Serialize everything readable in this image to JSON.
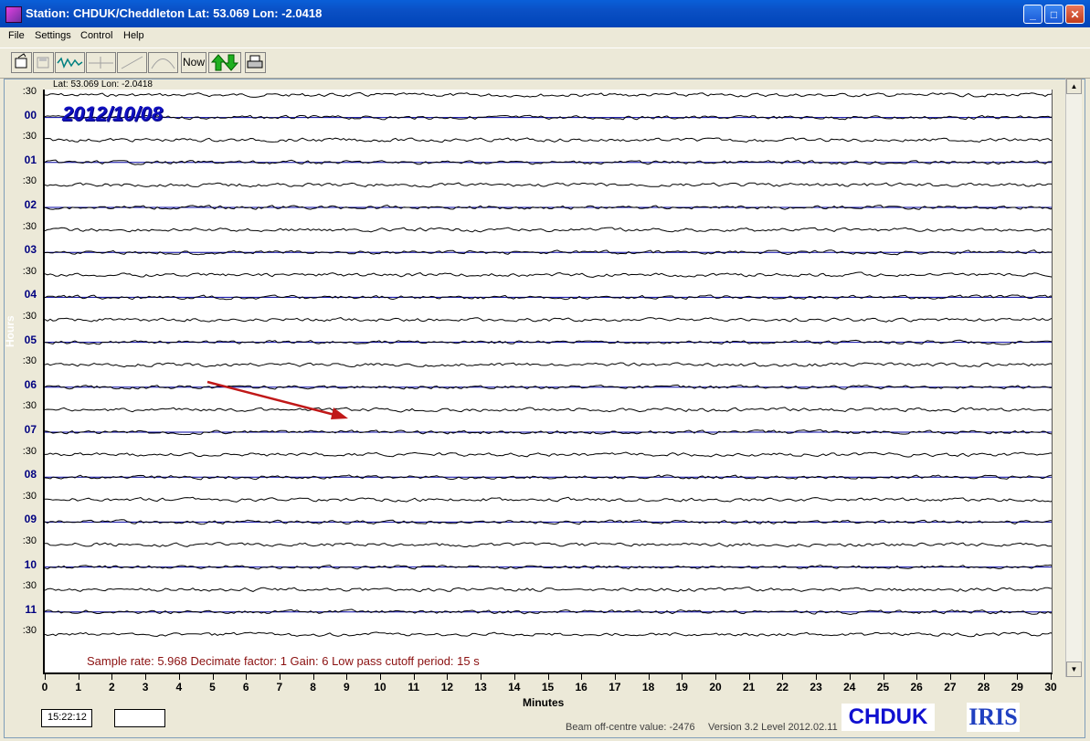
{
  "window": {
    "title": "Station: CHDUK/Cheddleton Lat: 53.069 Lon: -2.0418",
    "minimize_glyph": "_",
    "maximize_glyph": "□",
    "close_glyph": "✕"
  },
  "menu": [
    "File",
    "Settings",
    "Control",
    "Help"
  ],
  "toolbar": {
    "icons": [
      "open-file-icon",
      "save-icon",
      "waveform-icon",
      "marker-icon",
      "slope-icon",
      "filter-icon"
    ],
    "now_label": "Now",
    "updown_icon": "green-up-down-arrows-icon",
    "print_icon": "printer-icon"
  },
  "plot": {
    "latlon": "Lat: 53.069 Lon: -2.0418",
    "date": "2012/10/08",
    "y_axis_title": "Hours",
    "row_labels": [
      ":30",
      "00",
      ":30",
      "01",
      ":30",
      "02",
      ":30",
      "03",
      ":30",
      "04",
      ":30",
      "05",
      ":30",
      "06",
      ":30",
      "07",
      ":30",
      "08",
      ":30",
      "09",
      ":30",
      "10",
      ":30",
      "11",
      ":30"
    ],
    "x_axis_title": "Minutes",
    "x_ticks": [
      "0",
      "1",
      "2",
      "3",
      "4",
      "5",
      "6",
      "7",
      "8",
      "9",
      "10",
      "11",
      "12",
      "13",
      "14",
      "15",
      "16",
      "17",
      "18",
      "19",
      "20",
      "21",
      "22",
      "23",
      "24",
      "25",
      "26",
      "27",
      "28",
      "29",
      "30"
    ],
    "info": "Sample rate: 5.968  Decimate factor: 1  Gain: 6  Low pass cutoff period: 15 s",
    "trace_color": "#000000",
    "baseline_color": "#0000a0",
    "arrow_color": "#c01818"
  },
  "scrollbar": {
    "up_glyph": "▲",
    "down_glyph": "▼"
  },
  "status": {
    "time": "15:22:12",
    "blank_box": "",
    "beam": "Beam off-centre value: -2476",
    "version": "Version 3.2 Level 2012.02.11"
  },
  "logos": {
    "station": "CHDUK",
    "iris": "IRIS"
  }
}
